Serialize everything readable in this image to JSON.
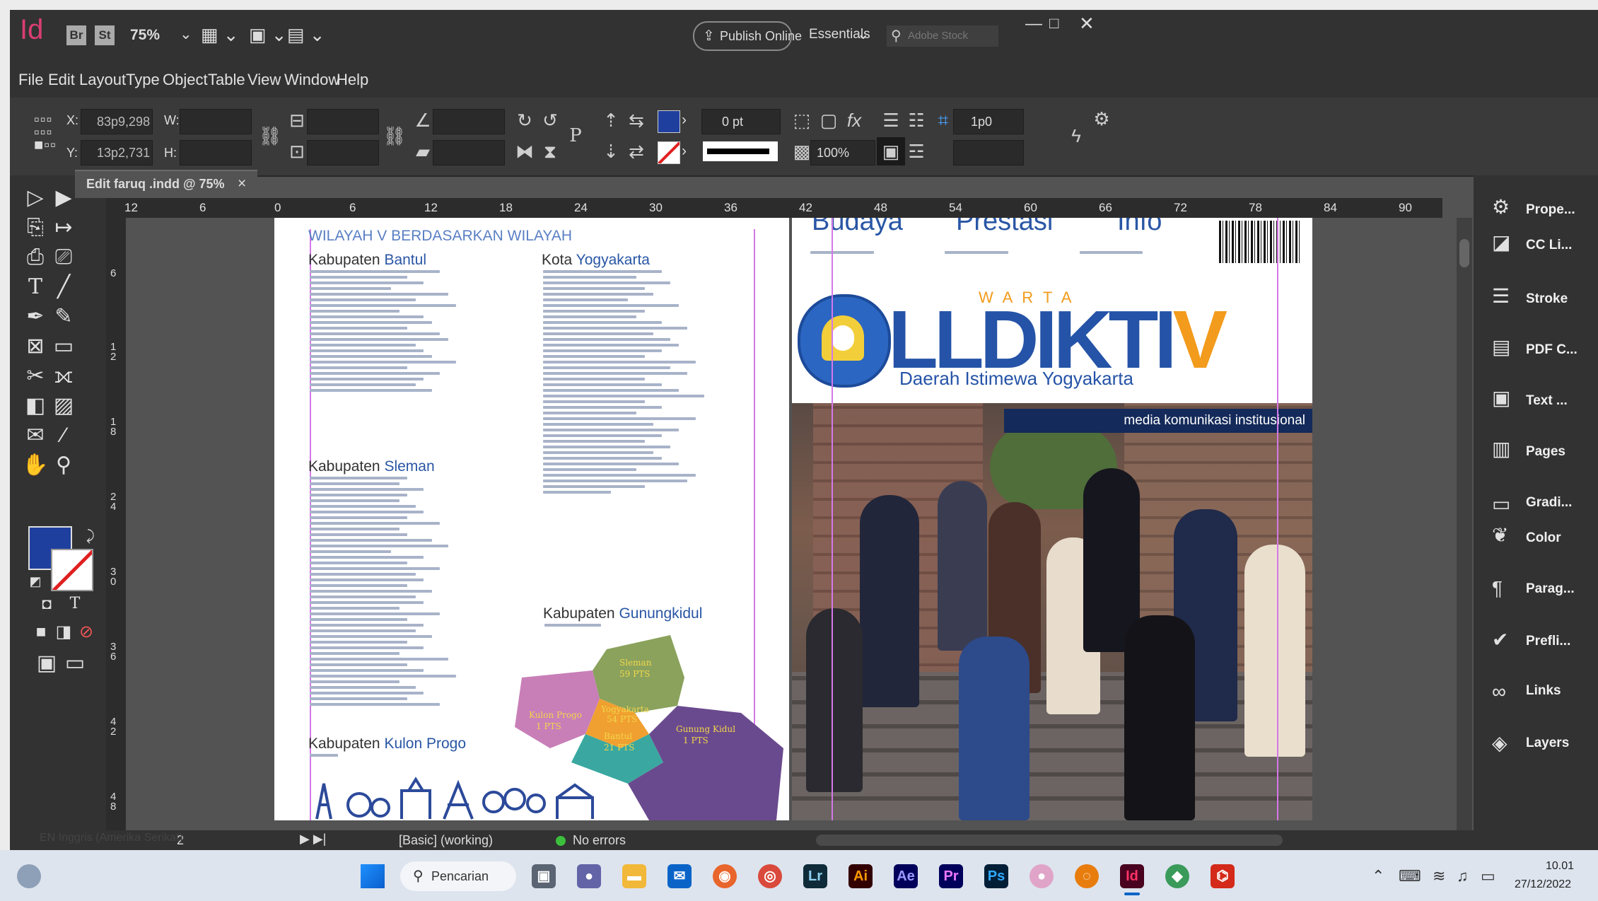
{
  "app": {
    "logo": "Id",
    "bridge": "Br",
    "stock": "St",
    "zoom": "75%",
    "publish": "Publish Online",
    "workspace": "Essentials",
    "search_placeholder": "Adobe Stock",
    "accent": "#da3e73"
  },
  "menu": [
    "File",
    "Edit",
    "Layout",
    "Type",
    "Object",
    "Table",
    "View",
    "Window",
    "Help"
  ],
  "control": {
    "x_label": "X:",
    "x_value": "83p9,298",
    "y_label": "Y:",
    "y_value": "13p2,731",
    "w_label": "W:",
    "h_label": "H:",
    "stroke_weight": "0 pt",
    "opacity": "100%",
    "gutter": "1p0"
  },
  "doc_tab": {
    "title": "Edit faruq .indd @ 75%",
    "close": "×"
  },
  "ruler_h": [
    "12",
    "6",
    "0",
    "6",
    "12",
    "18",
    "24",
    "30",
    "36",
    "42",
    "48",
    "54",
    "60",
    "66",
    "72",
    "78",
    "84",
    "90"
  ],
  "ruler_v": [
    "6",
    "1\n2",
    "1\n8",
    "2\n4",
    "3\n0",
    "3\n6",
    "4\n2",
    "4\n8"
  ],
  "left_page": {
    "heading": "WILAYAH V BERDASARKAN WILAYAH",
    "bantul_a": "Kabupaten ",
    "bantul_b": "Bantul",
    "kota_a": "Kota ",
    "kota_b": "Yogyakarta",
    "sleman_a": "Kabupaten ",
    "sleman_b": "Sleman",
    "gk_a": "Kabupaten ",
    "gk_b": "Gunungkidul",
    "kp_a": "Kabupaten ",
    "kp_b": "Kulon Progo",
    "map": {
      "sleman": "Sleman",
      "sleman_pts": "59 PTS",
      "yogya": "Yogyakarta",
      "yogya_pts": "54 PTS",
      "kp": "Kulon Progo",
      "kp_pts": "1 PTS",
      "bantul": "Bantul",
      "bantul_pts": "21 PTS",
      "gk": "Gunung Kidul",
      "gk_pts": "1 PTS"
    }
  },
  "right_page": {
    "top_items": [
      "Budaya",
      "Prestasi",
      "Info"
    ],
    "warta": "W A R T A",
    "brand_a": "LLDIKTI",
    "brand_b": "V",
    "region": "Daerah Istimewa Yogyakarta",
    "tagline": "media komunikasi institusional"
  },
  "panels": [
    "Prope...",
    "CC Li...",
    "Stroke",
    "PDF C...",
    "Text ...",
    "Pages",
    "Gradi...",
    "Color",
    "Parag...",
    "Prefli...",
    "Links",
    "Layers"
  ],
  "status": {
    "page": "2",
    "style": "[Basic] (working)",
    "errors": "No errors",
    "lang": "EN Inggris (Amerika Serikat)"
  },
  "taskbar": {
    "search": "Pencarian",
    "time": "10.01",
    "date": "27/12/2022"
  }
}
